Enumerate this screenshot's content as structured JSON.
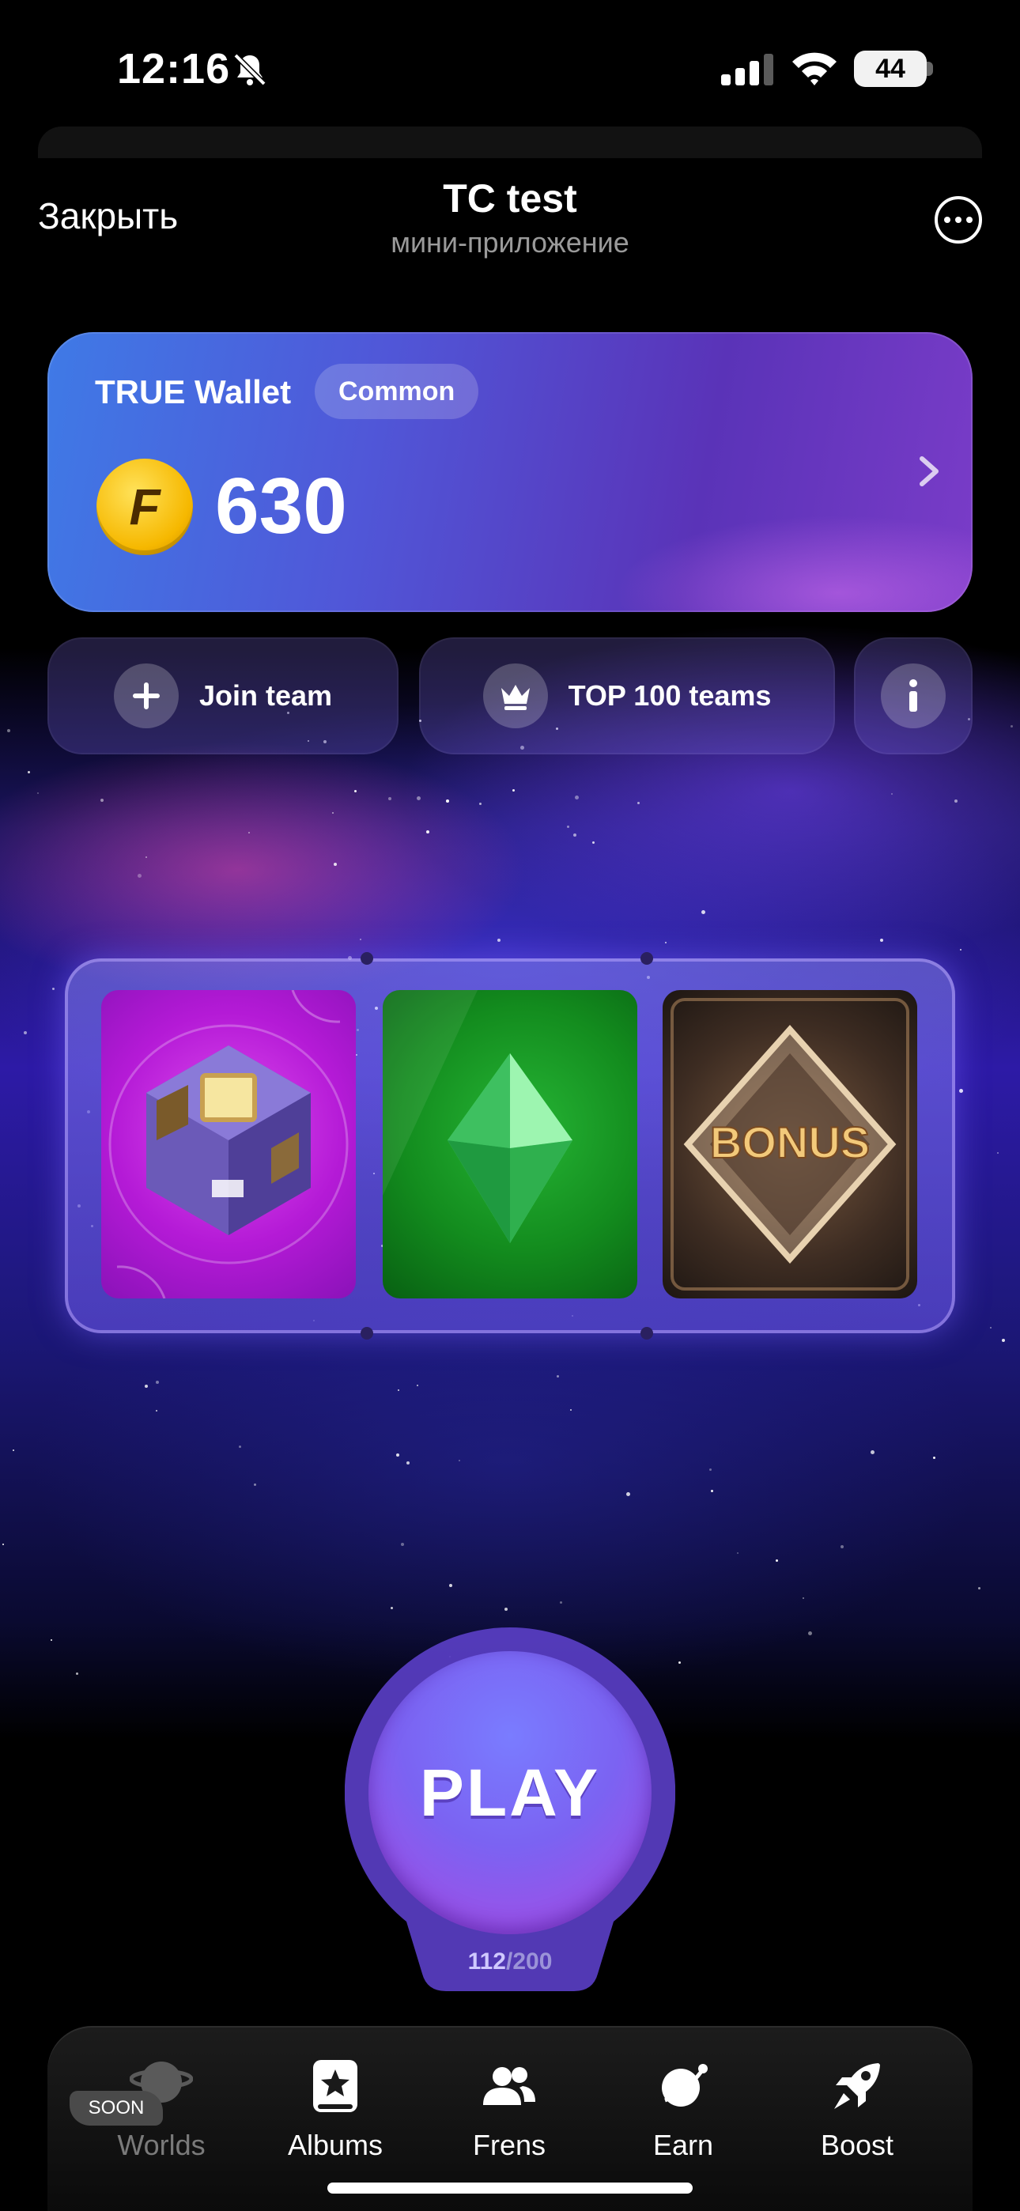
{
  "status_bar": {
    "time": "12:16",
    "battery": "44"
  },
  "header": {
    "close_label": "Закрыть",
    "title": "TC test",
    "subtitle": "мини-приложение"
  },
  "wallet": {
    "name": "TRUE Wallet",
    "tier": "Common",
    "balance": "630",
    "coin_letter": "F"
  },
  "actions": {
    "join_team": "Join team",
    "top_teams": "TOP 100 teams"
  },
  "cards": [
    {
      "name": "card-cube"
    },
    {
      "name": "card-gem"
    },
    {
      "name": "card-bonus",
      "label": "BONUS"
    }
  ],
  "play": {
    "label": "PLAY",
    "energy_current": "112",
    "energy_separator": "/",
    "energy_max": "200"
  },
  "nav": {
    "soon_badge": "SOON",
    "items": [
      {
        "label": "Worlds",
        "icon": "globe-icon"
      },
      {
        "label": "Albums",
        "icon": "album-star-icon"
      },
      {
        "label": "Frens",
        "icon": "users-icon"
      },
      {
        "label": "Earn",
        "icon": "planet-icon"
      },
      {
        "label": "Boost",
        "icon": "rocket-icon"
      }
    ]
  },
  "colors": {
    "accent": "#7b63f2",
    "wallet_start": "#3f7ae6",
    "wallet_end": "#7a3cc8",
    "coin": "#f6b800"
  }
}
